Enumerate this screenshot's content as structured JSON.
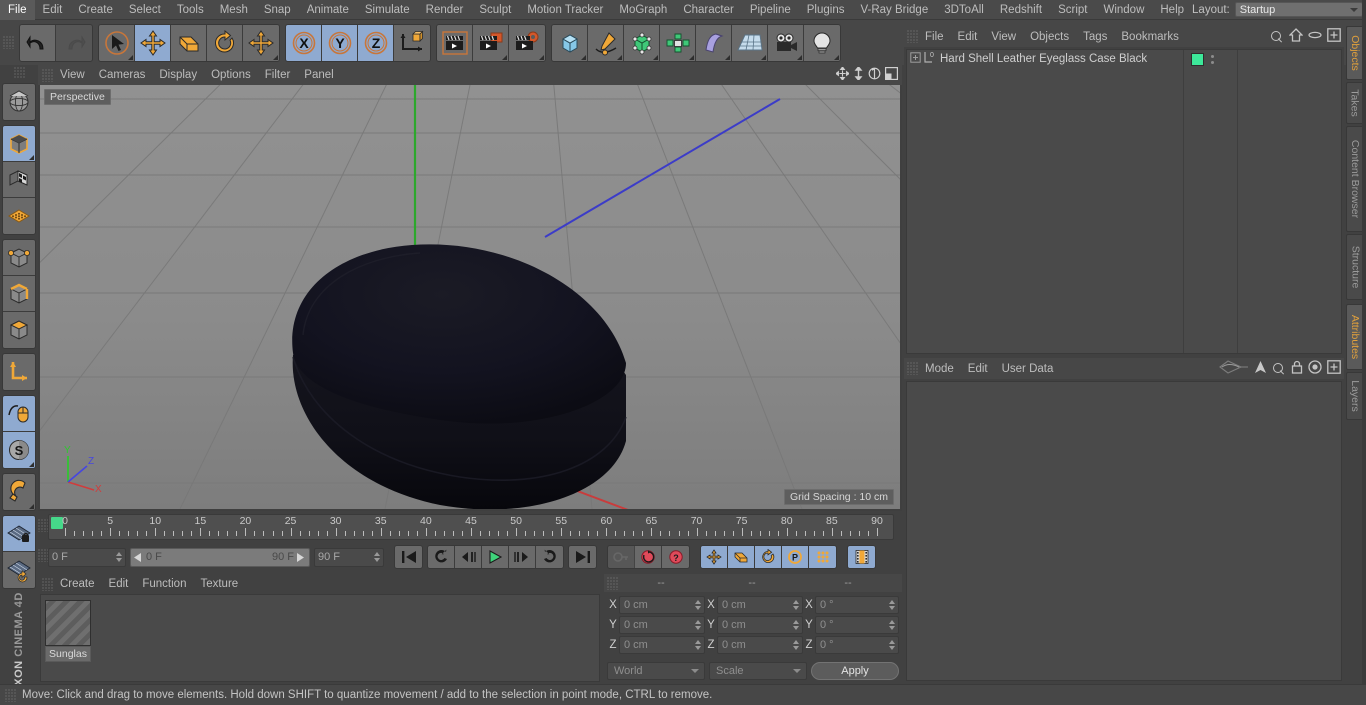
{
  "app": {
    "title": "CINEMA 4D",
    "brand_prefix": "MAXON",
    "brand_name": "CINEMA 4D"
  },
  "menu": {
    "items": [
      {
        "label": "File"
      },
      {
        "label": "Edit"
      },
      {
        "label": "Create"
      },
      {
        "label": "Select"
      },
      {
        "label": "Tools"
      },
      {
        "label": "Mesh"
      },
      {
        "label": "Snap"
      },
      {
        "label": "Animate"
      },
      {
        "label": "Simulate"
      },
      {
        "label": "Render"
      },
      {
        "label": "Sculpt"
      },
      {
        "label": "Motion Tracker"
      },
      {
        "label": "MoGraph"
      },
      {
        "label": "Character"
      },
      {
        "label": "Pipeline"
      },
      {
        "label": "Plugins"
      },
      {
        "label": "V-Ray Bridge"
      },
      {
        "label": "3DToAll"
      },
      {
        "label": "Redshift"
      },
      {
        "label": "Script"
      },
      {
        "label": "Window"
      },
      {
        "label": "Help"
      }
    ],
    "layout_label": "Layout:",
    "layout_value": "Startup",
    "search_icon": "search-icon"
  },
  "toolbar": {
    "groups": [
      {
        "name": "history",
        "buttons": [
          {
            "name": "undo-button",
            "icon": "undo-arrow-icon",
            "state": "normal"
          },
          {
            "name": "redo-button",
            "icon": "redo-arrow-icon",
            "state": "disabled"
          }
        ]
      },
      {
        "name": "transform-tools",
        "buttons": [
          {
            "name": "live-selection-tool",
            "icon": "cursor-circle-icon",
            "state": "normal"
          },
          {
            "name": "move-tool",
            "icon": "move-arrows-icon",
            "state": "active"
          },
          {
            "name": "scale-tool",
            "icon": "scale-box-icon",
            "state": "normal"
          },
          {
            "name": "rotate-tool",
            "icon": "rotate-arc-icon",
            "state": "normal"
          },
          {
            "name": "drag-tool",
            "icon": "move-arrows-icon",
            "state": "normal"
          }
        ]
      },
      {
        "name": "axis-locks",
        "buttons": [
          {
            "name": "x-axis-lock",
            "icon": "x-axis-icon",
            "state": "active",
            "label": "X"
          },
          {
            "name": "y-axis-lock",
            "icon": "y-axis-icon",
            "state": "active",
            "label": "Y"
          },
          {
            "name": "z-axis-lock",
            "icon": "z-axis-icon",
            "state": "active",
            "label": "Z"
          },
          {
            "name": "world-object-coordinates",
            "icon": "world-axis-cube-icon",
            "state": "normal"
          }
        ]
      },
      {
        "name": "render-tools",
        "buttons": [
          {
            "name": "render-view-button",
            "icon": "clapper-frame-icon",
            "state": "normal"
          },
          {
            "name": "render-to-picture-viewer-button",
            "icon": "clapper-picture-icon",
            "state": "normal"
          },
          {
            "name": "render-settings-button",
            "icon": "clapper-gear-icon",
            "state": "normal"
          }
        ]
      },
      {
        "name": "create-objects",
        "buttons": [
          {
            "name": "add-primitive-cube-button",
            "icon": "blue-cube-icon",
            "state": "normal"
          },
          {
            "name": "add-spline-button",
            "icon": "pen-spline-icon",
            "state": "normal"
          },
          {
            "name": "add-generator-button",
            "icon": "green-cube-cage-icon",
            "state": "normal"
          },
          {
            "name": "add-modeling-object-button",
            "icon": "green-array-icon",
            "state": "normal"
          },
          {
            "name": "add-deformer-button",
            "icon": "bend-deformer-icon",
            "state": "normal"
          },
          {
            "name": "add-environment-button",
            "icon": "floor-grid-icon",
            "state": "normal"
          },
          {
            "name": "add-camera-button",
            "icon": "camera-icon",
            "state": "normal"
          },
          {
            "name": "add-light-button",
            "icon": "lightbulb-icon",
            "state": "normal"
          }
        ]
      }
    ]
  },
  "left_toolbar": {
    "groups": [
      {
        "buttons": [
          {
            "name": "make-editable-button",
            "icon": "globe-wire-icon",
            "state": "normal"
          }
        ]
      },
      {
        "buttons": [
          {
            "name": "model-mode-button",
            "icon": "solid-cube-icon",
            "state": "active"
          },
          {
            "name": "texture-mode-button",
            "icon": "checker-cube-icon",
            "state": "normal"
          },
          {
            "name": "workplane-mode-button",
            "icon": "orange-grid-icon",
            "state": "normal"
          }
        ]
      },
      {
        "buttons": [
          {
            "name": "points-mode-button",
            "icon": "cube-points-icon",
            "state": "normal"
          },
          {
            "name": "edges-mode-button",
            "icon": "cube-edges-icon",
            "state": "normal"
          },
          {
            "name": "polygons-mode-button",
            "icon": "cube-polygons-icon",
            "state": "normal"
          }
        ]
      },
      {
        "buttons": [
          {
            "name": "object-axis-mode-button",
            "icon": "axis-corner-icon",
            "state": "normal"
          }
        ]
      },
      {
        "buttons": [
          {
            "name": "viewport-solo-button",
            "icon": "mouse-curve-icon",
            "state": "active"
          },
          {
            "name": "soft-selection-button",
            "icon": "s-sphere-icon",
            "state": "active"
          }
        ]
      },
      {
        "buttons": [
          {
            "name": "magnet-tool-button",
            "icon": "magnet-icon",
            "state": "normal"
          }
        ]
      },
      {
        "buttons": [
          {
            "name": "workplane-lock-button",
            "icon": "grid-lock-icon",
            "state": "active"
          },
          {
            "name": "planar-rotation-button",
            "icon": "grid-rotate-icon",
            "state": "normal"
          }
        ]
      }
    ]
  },
  "viewport": {
    "menu": [
      {
        "label": "View"
      },
      {
        "label": "Cameras"
      },
      {
        "label": "Display"
      },
      {
        "label": "Options"
      },
      {
        "label": "Filter"
      },
      {
        "label": "Panel"
      }
    ],
    "icons": [
      {
        "name": "viewport-pan-icon"
      },
      {
        "name": "viewport-dolly-icon"
      },
      {
        "name": "viewport-rotate-icon"
      },
      {
        "name": "viewport-maximize-icon"
      }
    ],
    "label": "Perspective",
    "grid_spacing": "Grid Spacing : 10 cm",
    "axis": {
      "x": "X",
      "y": "Y",
      "z": "Z",
      "x_color": "#d04040",
      "y_color": "#3fc33f",
      "z_color": "#4848d8"
    },
    "object_color": "#121218",
    "background_top": "#8e8e8e",
    "background_bottom": "#7b7b7b"
  },
  "timeline": {
    "ticks": [
      "0",
      "5",
      "10",
      "15",
      "20",
      "25",
      "30",
      "35",
      "40",
      "45",
      "50",
      "55",
      "60",
      "65",
      "70",
      "75",
      "80",
      "85",
      "90"
    ],
    "current_frame_field": "0 F",
    "range_start": "0 F",
    "range_end": "90 F",
    "max_frame_field": "90 F",
    "end_field": "0 F",
    "playback_buttons": [
      {
        "name": "go-to-start-button",
        "icon": "skip-start-icon",
        "state": "normal"
      },
      {
        "name": "previous-key-button",
        "icon": "rewind-key-icon",
        "state": "normal"
      },
      {
        "name": "step-back-button",
        "icon": "step-back-icon",
        "state": "normal"
      },
      {
        "name": "play-button",
        "icon": "play-icon",
        "state": "normal"
      },
      {
        "name": "step-forward-button",
        "icon": "step-forward-icon",
        "state": "normal"
      },
      {
        "name": "next-key-button",
        "icon": "forward-key-icon",
        "state": "normal"
      },
      {
        "name": "go-to-end-button",
        "icon": "skip-end-icon",
        "state": "normal"
      }
    ],
    "key_buttons": [
      {
        "name": "record-active-objects-button",
        "icon": "key-icon",
        "state": "disabled"
      },
      {
        "name": "autokeying-button",
        "icon": "red-circle-arrow-icon",
        "state": "normal"
      },
      {
        "name": "keyframe-selection-button",
        "icon": "red-question-icon",
        "state": "normal"
      }
    ],
    "pos_buttons": [
      {
        "name": "record-position-button",
        "icon": "move-arrows-icon",
        "state": "active"
      },
      {
        "name": "record-scale-button",
        "icon": "scale-box-icon",
        "state": "active"
      },
      {
        "name": "record-rotation-button",
        "icon": "rotate-arc-icon",
        "state": "active"
      },
      {
        "name": "record-parameter-button",
        "icon": "p-circle-icon",
        "state": "active"
      },
      {
        "name": "record-pla-button",
        "icon": "dot-matrix-icon",
        "state": "active"
      }
    ],
    "sound_button": {
      "name": "timeline-filmstrip-button",
      "icon": "filmstrip-icon",
      "state": "active"
    }
  },
  "material_manager": {
    "menu": [
      {
        "label": "Create"
      },
      {
        "label": "Edit"
      },
      {
        "label": "Function"
      },
      {
        "label": "Texture"
      }
    ],
    "materials": [
      {
        "name": "Sunglas"
      }
    ]
  },
  "coordinates": {
    "headers": [
      "--",
      "--",
      "--"
    ],
    "rows": [
      {
        "axis": "X",
        "position": "0 cm",
        "size": "0 cm",
        "rotation": "0 °"
      },
      {
        "axis": "Y",
        "position": "0 cm",
        "size": "0 cm",
        "rotation": "0 °"
      },
      {
        "axis": "Z",
        "position": "0 cm",
        "size": "0 cm",
        "rotation": "0 °"
      }
    ],
    "coord_system": "World",
    "mode": "Scale",
    "apply_label": "Apply"
  },
  "object_manager": {
    "menu": [
      {
        "label": "File"
      },
      {
        "label": "Edit"
      },
      {
        "label": "View"
      },
      {
        "label": "Objects"
      },
      {
        "label": "Tags"
      },
      {
        "label": "Bookmarks"
      }
    ],
    "icons": [
      {
        "name": "search-icon"
      },
      {
        "name": "home-icon"
      },
      {
        "name": "ellipse-icon"
      },
      {
        "name": "new-layer-icon"
      }
    ],
    "objects": [
      {
        "name": "Hard Shell Leather Eyeglass Case Black",
        "tag_color": "#3de89a",
        "level": "0"
      }
    ]
  },
  "attribute_manager": {
    "menu": [
      {
        "label": "Mode"
      },
      {
        "label": "Edit"
      },
      {
        "label": "User Data"
      }
    ],
    "icons": [
      {
        "name": "animate-curve-icon"
      },
      {
        "name": "pointer-up-icon"
      },
      {
        "name": "search-icon"
      },
      {
        "name": "lock-icon"
      },
      {
        "name": "target-icon"
      },
      {
        "name": "new-layer-icon"
      }
    ]
  },
  "right_tabs": {
    "upper": [
      {
        "label": "Objects",
        "selected": true
      },
      {
        "label": "Takes",
        "selected": false
      },
      {
        "label": "Content Browser",
        "selected": false
      },
      {
        "label": "Structure",
        "selected": false
      }
    ],
    "lower": [
      {
        "label": "Attributes",
        "selected": true
      },
      {
        "label": "Layers",
        "selected": false
      }
    ]
  },
  "statusbar": {
    "message": "Move: Click and drag to move elements. Hold down SHIFT to quantize movement / add to the selection in point mode, CTRL to remove."
  }
}
